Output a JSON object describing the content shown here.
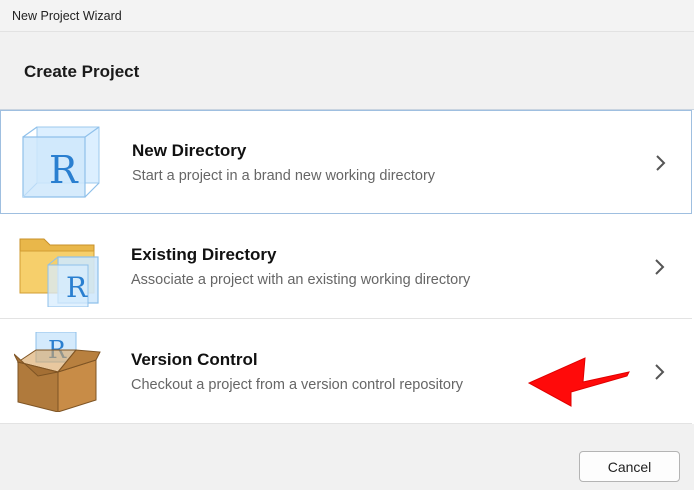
{
  "window": {
    "title": "New Project Wizard"
  },
  "header": {
    "title": "Create Project"
  },
  "options": [
    {
      "name": "New Directory",
      "description": "Start a project in a brand new working directory",
      "icon": "r-cube-icon"
    },
    {
      "name": "Existing Directory",
      "description": "Associate a project with an existing working directory",
      "icon": "folder-r-icon"
    },
    {
      "name": "Version Control",
      "description": "Checkout a project from a version control repository",
      "icon": "box-r-icon"
    }
  ],
  "footer": {
    "cancel_label": "Cancel"
  },
  "colors": {
    "selected_border": "#9fbfe0",
    "annotation_arrow": "#ff0000",
    "r_blue": "#2a7fd0"
  }
}
